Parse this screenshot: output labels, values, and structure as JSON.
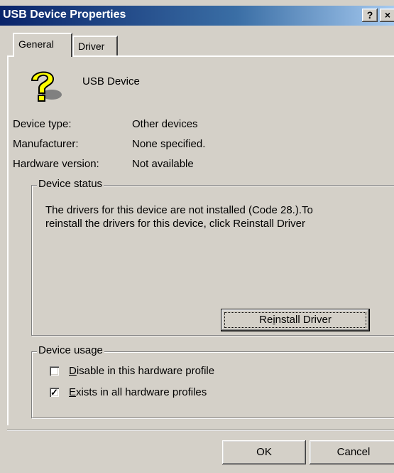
{
  "window": {
    "title": "USB Device Properties",
    "help_button": "?",
    "close_button": "×"
  },
  "tabs": [
    {
      "label": "General"
    },
    {
      "label": "Driver"
    }
  ],
  "device": {
    "name": "USB Device",
    "icon": "unknown-device-question-icon",
    "props": [
      {
        "label": "Device type:",
        "value": "Other devices"
      },
      {
        "label": "Manufacturer:",
        "value": "None specified."
      },
      {
        "label": "Hardware version:",
        "value": "Not available"
      }
    ]
  },
  "status": {
    "legend": "Device status",
    "text_line1": "The drivers for this device are not installed  (Code 28.).To",
    "text_line2": "reinstall the drivers for this device, click Reinstall Driver",
    "reinstall_pre": "Re",
    "reinstall_u": "i",
    "reinstall_post": "nstall Driver"
  },
  "usage": {
    "legend": "Device usage",
    "options": [
      {
        "u": "D",
        "rest": "isable in this hardware profile",
        "checked": false
      },
      {
        "u": "E",
        "rest": "xists in all hardware profiles",
        "checked": true
      }
    ],
    "check_mark": "✓"
  },
  "footer": {
    "ok": "OK",
    "cancel": "Cancel"
  }
}
